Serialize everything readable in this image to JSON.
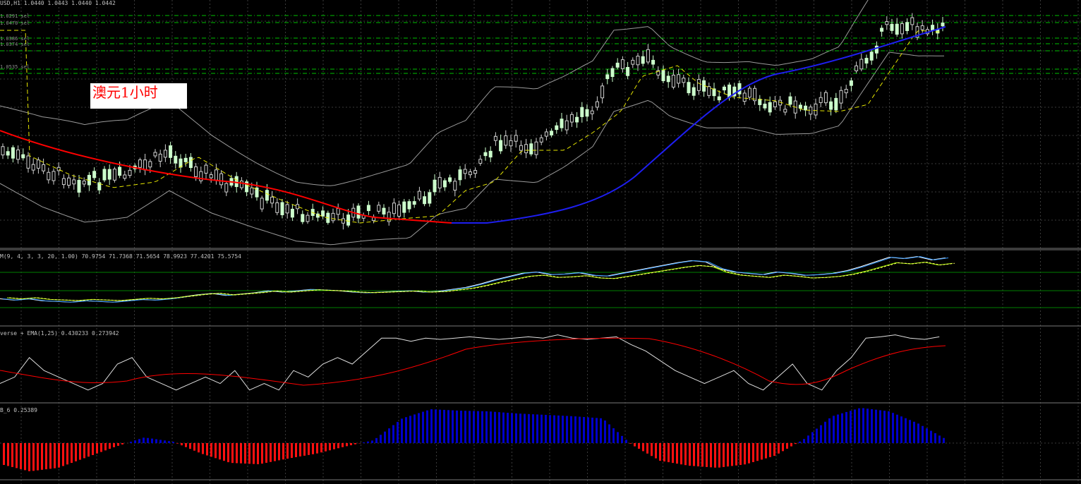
{
  "main_header": "USD,H1  1.0440 1.0443 1.0440 1.0442",
  "price_levels": [
    "1.0291 sel",
    "1.0470 sel",
    "1.0386 sel",
    "1.0374 sel",
    "1.0535 sel"
  ],
  "chart_label": "澳元1小时",
  "panels": {
    "stochastic_header": "M(9, 4, 3, 3, 20, 1.00) 70.9754 71.7368 71.5654 78.9923 77.4201 75.5754",
    "rsi_header": "verse + EMA(1,25) 0.430233 0.273942",
    "histogram_header": "B_6 0.25389"
  },
  "colors": {
    "background": "#000000",
    "grid": "#3a3a3a",
    "bull_candle": "#ccffcc",
    "bear_candle": "#d0d0d0",
    "ma_red": "#ff0000",
    "ma_blue": "#1e1ef0",
    "ma_yellow_dash": "#e6e600",
    "bands": "#9a9a9a",
    "levels": "#00c000",
    "hist_pos": "#0000cc",
    "hist_neg": "#ff1010"
  },
  "chart_data": {
    "type": "line",
    "series": [
      {
        "values": [
          0.3,
          0.28,
          0.3,
          0.27,
          0.26,
          0.25,
          0.27,
          0.26,
          0.25,
          0.27,
          0.29,
          0.28,
          0.3,
          0.33,
          0.36,
          0.38,
          0.35,
          0.37,
          0.39,
          0.42,
          0.4,
          0.42,
          0.44,
          0.43,
          0.42,
          0.4,
          0.39,
          0.4,
          0.41,
          0.42,
          0.4,
          0.41,
          0.44,
          0.47,
          0.52,
          0.58,
          0.63,
          0.68,
          0.7,
          0.66,
          0.67,
          0.69,
          0.65,
          0.64,
          0.68,
          0.72,
          0.76,
          0.8,
          0.84,
          0.87,
          0.85,
          0.75,
          0.7,
          0.68,
          0.66,
          0.7,
          0.68,
          0.65,
          0.66,
          0.68,
          0.72,
          0.78,
          0.85,
          0.92,
          0.9,
          0.93,
          0.88,
          0.91
        ]
      },
      {
        "values": [
          0.2,
          0.3,
          0.6,
          0.4,
          0.3,
          0.2,
          0.1,
          0.2,
          0.5,
          0.6,
          0.3,
          0.2,
          0.1,
          0.2,
          0.3,
          0.2,
          0.4,
          0.1,
          0.2,
          0.1,
          0.4,
          0.3,
          0.5,
          0.6,
          0.5,
          0.7,
          0.9,
          0.9,
          0.85,
          0.9,
          0.88,
          0.9,
          0.92,
          0.9,
          0.88,
          0.9,
          0.92,
          0.9,
          0.95,
          0.9,
          0.88,
          0.9,
          0.92,
          0.8,
          0.7,
          0.55,
          0.4,
          0.3,
          0.2,
          0.3,
          0.4,
          0.2,
          0.1,
          0.3,
          0.5,
          0.2,
          0.1,
          0.4,
          0.6,
          0.9,
          0.92,
          0.95,
          0.9,
          0.88,
          0.92
        ]
      },
      {
        "values": [
          -0.3,
          -0.4,
          -0.35,
          -0.2,
          -0.05,
          0.08,
          0.02,
          -0.15,
          -0.28,
          -0.3,
          -0.22,
          -0.15,
          -0.05,
          0.04,
          0.35,
          0.48,
          0.46,
          0.45,
          0.42,
          0.4,
          0.38,
          0.35,
          -0.02,
          -0.25,
          -0.32,
          -0.35,
          -0.3,
          -0.18,
          0.05,
          0.38,
          0.5,
          0.45,
          0.28,
          0.05
        ]
      }
    ]
  }
}
